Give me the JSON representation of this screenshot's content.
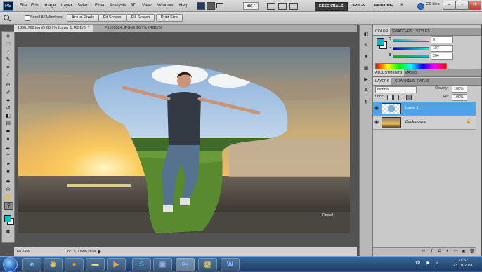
{
  "app": {
    "logo_text": "PS",
    "menu": [
      "File",
      "Edit",
      "Image",
      "Layer",
      "Select",
      "Filter",
      "Analysis",
      "3D",
      "View",
      "Window",
      "Help"
    ],
    "zoom_value": "68,7",
    "workspaces": [
      "ESSENTIALS",
      "DESIGN",
      "PAINTING"
    ],
    "more_workspaces": "»",
    "cs_live": "CS Live"
  },
  "options": {
    "scroll_all_windows": "Scroll All Windows",
    "buttons": [
      "Actual Pixels",
      "Fit Screen",
      "Fill Screen",
      "Print Size"
    ]
  },
  "documents": {
    "tabs": [
      "1366x768.jpg @ 68,7% (Layer 1, RGB/8) *",
      "P1000524.JPG @ 16,7% (RGB/8)"
    ],
    "caption": "Fimsel"
  },
  "status": {
    "zoom": "68,74%",
    "doc": "Doc: 3,00M/6,00M"
  },
  "color_panel": {
    "tabs": [
      "COLOR",
      "SWATCHES",
      "STYLES"
    ],
    "channels": [
      {
        "label": "R",
        "value": "0",
        "level": 0.0
      },
      {
        "label": "G",
        "value": "187",
        "level": 0.73
      },
      {
        "label": "B",
        "value": "204",
        "level": 0.8
      }
    ]
  },
  "adjust_panel": {
    "tabs": [
      "ADJUSTMENTS",
      "MASKS"
    ]
  },
  "layers_panel": {
    "tabs": [
      "LAYERS",
      "CHANNELS",
      "PATHS"
    ],
    "blend_mode": "Normal",
    "opacity_label": "Opacity:",
    "opacity_value": "100%",
    "lock_label": "Lock:",
    "fill_label": "Fill:",
    "fill_value": "100%",
    "layers": [
      {
        "name": "Layer 1",
        "selected": true
      },
      {
        "name": "Background",
        "selected": false
      }
    ]
  },
  "taskbar": {
    "apps": [
      "ie-icon",
      "chrome-icon",
      "firefox-icon",
      "folder-icon",
      "media-player-icon",
      "skype-icon",
      "app-icon",
      "photoshop-icon",
      "image-viewer-icon",
      "word-icon"
    ],
    "language": "TR",
    "time": "21:57",
    "date": "23.10.2011"
  },
  "colors": {
    "accent_selected": "#4fa3e8",
    "foreground_swatch": "#00bbcc",
    "taskbar": "#1c3c62"
  }
}
